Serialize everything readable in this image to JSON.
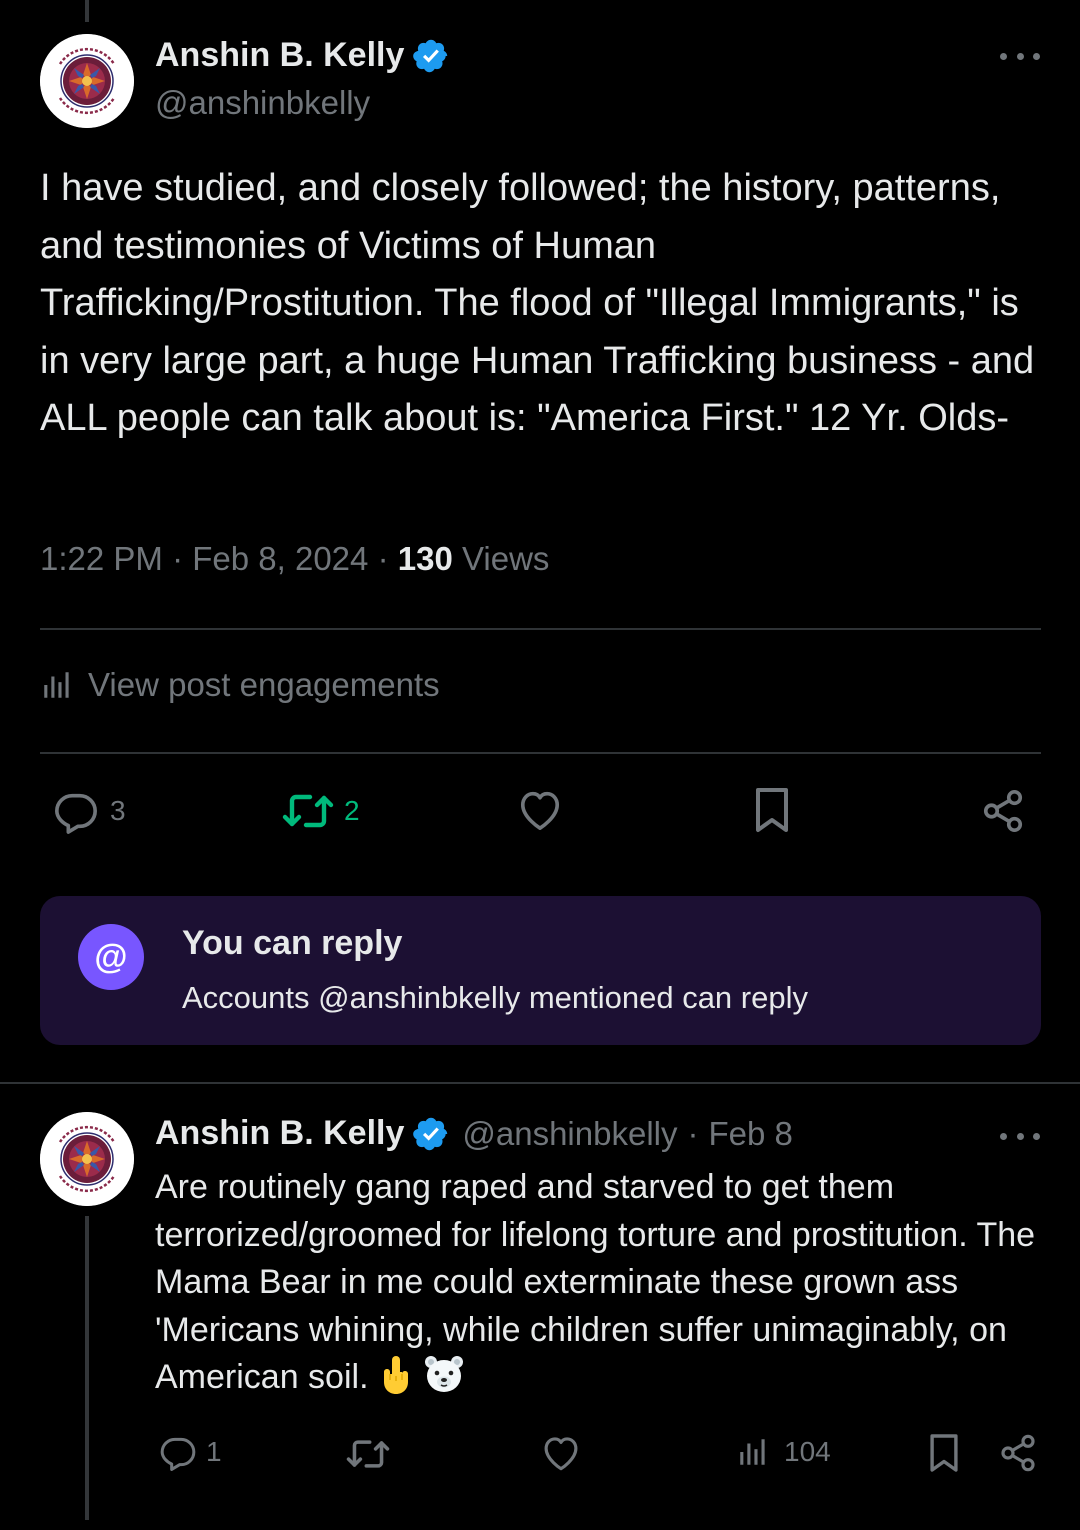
{
  "main_post": {
    "author": {
      "display_name": "Anshin B. Kelly",
      "handle": "@anshinbkelly",
      "verified": true,
      "avatar_text_top": "KaleidoShin",
      "avatar_text_bottom": "Healing, Arts, Health"
    },
    "text": "I have studied, and closely followed; the history, patterns, and testimonies of Victims of Human Trafficking/Prostitution. The flood of \"Illegal Immigrants,\" is in very large part, a huge Human Trafficking business - and ALL people can talk about is: \"America First.\" 12 Yr. Olds-",
    "time": "1:22 PM",
    "date": "Feb 8, 2024",
    "separator": "·",
    "views_count": "130",
    "views_label": "Views",
    "engagements_label": "View post engagements",
    "actions": {
      "reply_count": "3",
      "repost_count": "2",
      "like_count": "",
      "bookmark_count": ""
    },
    "icons": [
      "reply-icon",
      "repost-icon",
      "like-icon",
      "bookmark-icon",
      "share-icon",
      "analytics-icon",
      "more-icon",
      "verified-icon"
    ]
  },
  "reply_restriction": {
    "title": "You can reply",
    "subtitle": "Accounts @anshinbkelly mentioned can reply",
    "badge_symbol": "@"
  },
  "reply_post": {
    "author": {
      "display_name": "Anshin B. Kelly",
      "handle": "@anshinbkelly",
      "verified": true
    },
    "meta_separator": "·",
    "date": "Feb 8",
    "text": "Are routinely gang raped and starved to get them terrorized/groomed for lifelong torture and prostitution. The Mama Bear  in me could exterminate these grown ass 'Mericans whining, while children suffer unimaginably, on American soil.",
    "emojis": [
      "middle-finger-emoji",
      "polar-bear-emoji"
    ],
    "actions": {
      "reply_count": "1",
      "repost_count": "",
      "like_count": "",
      "views_count": "104"
    }
  },
  "colors": {
    "background": "#000000",
    "text_primary": "#e7e9ea",
    "text_secondary": "#71767b",
    "verified_blue": "#1d9bf0",
    "repost_green": "#00ba7c",
    "card_bg": "#1c1033",
    "badge_purple": "#7856ff",
    "divider": "#2f3336"
  }
}
